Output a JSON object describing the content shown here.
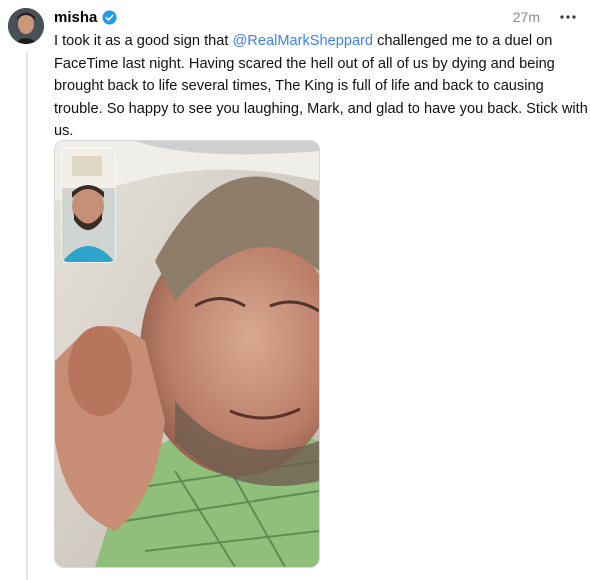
{
  "post": {
    "username": "misha",
    "time": "27m",
    "text_before": "I took it as a good sign that ",
    "mention": "@RealMarkSheppard",
    "text_after": " challenged me to a duel on FaceTime last night. Having scared the hell out of all of us by dying and being brought back to life several times, The King is full of life and back to causing trouble. So happy to see you laughing, Mark, and glad to have you back. Stick with us."
  },
  "icons": {
    "verified": "verified-badge-icon",
    "more": "more-options-icon"
  },
  "colors": {
    "mention": "#3b82f6",
    "verified": "#1d9bf0",
    "timestamp": "#8a8a8a"
  }
}
